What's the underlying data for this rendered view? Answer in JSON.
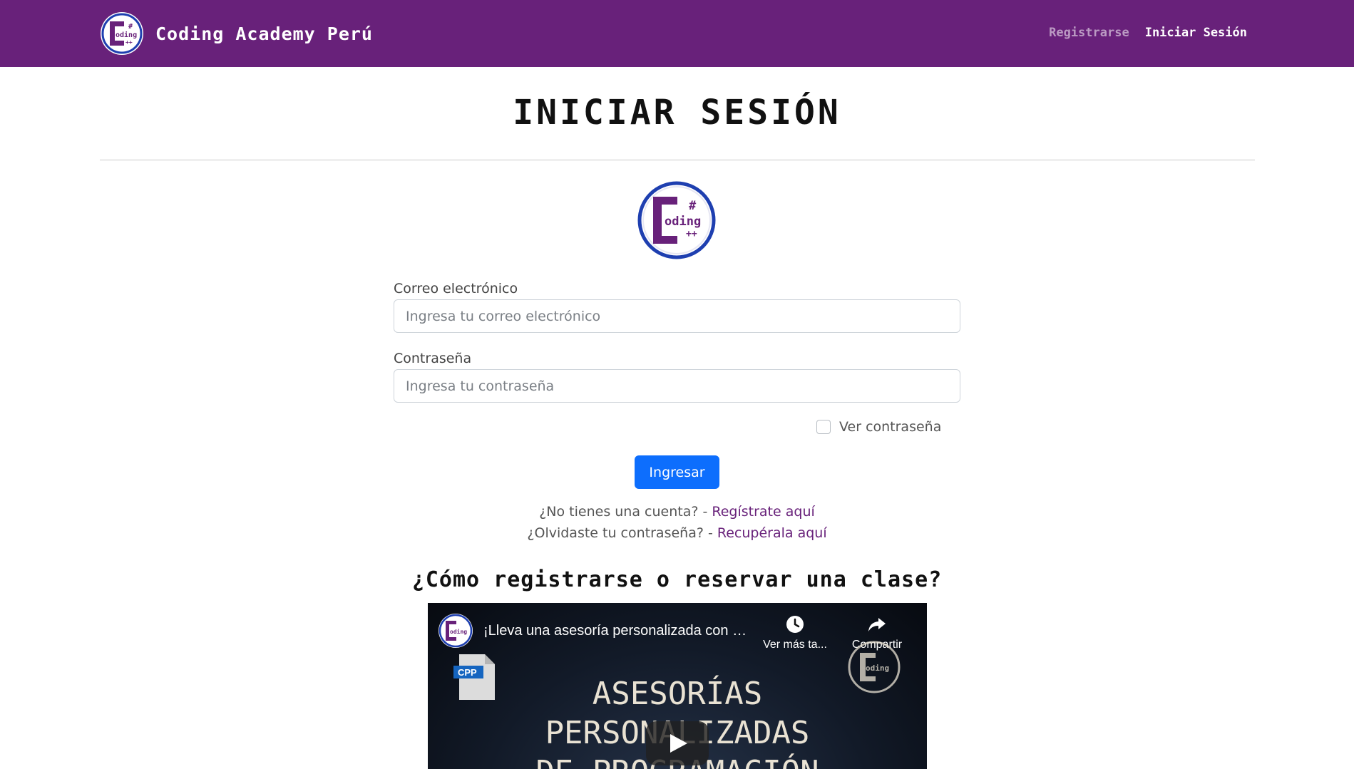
{
  "brand": {
    "name": "Coding Academy Perú",
    "logo_text": "oding"
  },
  "nav": {
    "register": "Registrarse",
    "login": "Iniciar Sesión"
  },
  "page_title": "INICIAR SESIÓN",
  "form": {
    "email_label": "Correo electrónico",
    "email_placeholder": "Ingresa tu correo electrónico",
    "password_label": "Contraseña",
    "password_placeholder": "Ingresa tu contraseña",
    "show_password": "Ver contraseña",
    "submit": "Ingresar"
  },
  "help": {
    "no_account": "¿No tienes una cuenta? - ",
    "register_link": "Regístrate aquí",
    "forgot": "¿Olvidaste tu contraseña? - ",
    "recover_link": "Recupérala aquí"
  },
  "section_title": "¿Cómo registrarse o reservar una clase?",
  "video": {
    "title": "¡Lleva una asesoría personalizada con nosotros!",
    "watch_later": "Ver más ta...",
    "share": "Compartir",
    "file_label": "CPP",
    "headline_1": "ASESORÍAS",
    "headline_2": "PERSONALIZADAS",
    "headline_3": "DE PROGRAMACIÓN"
  },
  "colors": {
    "primary_purple": "#68217a",
    "button_blue": "#0d6efd",
    "logo_ring_blue": "#1e3fb0"
  },
  "icons": [
    "coding-logo-icon",
    "clock-icon",
    "share-icon",
    "play-icon",
    "cpp-file-icon"
  ]
}
